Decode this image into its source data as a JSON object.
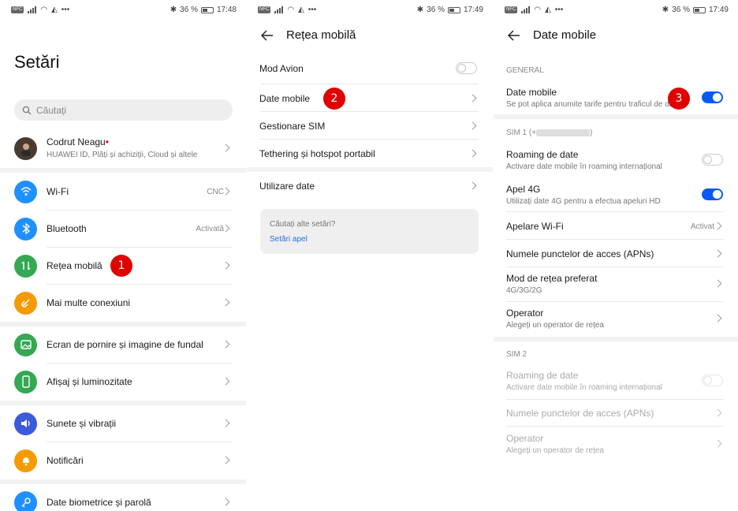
{
  "status": {
    "battery": "36 %",
    "time": "17:48",
    "time2": "17:49"
  },
  "colors": {
    "accent": "#0a59f7",
    "badge": "#e00000",
    "wifi": "#1e90ff",
    "bluetooth": "#1e90ff",
    "mobile": "#34a853",
    "more": "#f59b00",
    "home": "#34a853",
    "display": "#34a853",
    "sound": "#3b5bdb",
    "notif": "#f59b00",
    "bio": "#1e90ff"
  },
  "p1": {
    "title": "Setări",
    "search_placeholder": "Căutați",
    "account": {
      "name": "Codrut Neagu",
      "sub": "HUAWEI ID, Plăți și achiziții, Cloud și altele"
    },
    "items": [
      {
        "label": "Wi-Fi",
        "value": "CNC",
        "icon": "wifi-icon"
      },
      {
        "label": "Bluetooth",
        "value": "Activată",
        "icon": "bluetooth-icon"
      },
      {
        "label": "Rețea mobilă",
        "value": "",
        "icon": "mobile-network-icon"
      },
      {
        "label": "Mai multe conexiuni",
        "value": "",
        "icon": "link-icon"
      },
      {
        "label": "Ecran de pornire și imagine de fundal",
        "value": "",
        "icon": "image-icon"
      },
      {
        "label": "Afișaj și luminozitate",
        "value": "",
        "icon": "phone-icon"
      },
      {
        "label": "Sunete și vibrații",
        "value": "",
        "icon": "speaker-icon"
      },
      {
        "label": "Notificări",
        "value": "",
        "icon": "bell-icon"
      },
      {
        "label": "Date biometrice și parolă",
        "value": "",
        "icon": "key-icon"
      }
    ],
    "badge": "1"
  },
  "p2": {
    "title": "Rețea mobilă",
    "items": [
      "Mod Avion",
      "Date mobile",
      "Gestionare SIM",
      "Tethering și hotspot portabil",
      "Utilizare date"
    ],
    "help_question": "Căutați alte setări?",
    "help_link": "Setări apel",
    "badge": "2",
    "airplane_on": false
  },
  "p3": {
    "title": "Date mobile",
    "general": "GENERAL",
    "data_label": "Date mobile",
    "data_sub": "Se pot aplica anumite tarife pentru traficul de date",
    "sim1": "SIM 1 (+",
    "sim1_close": ")",
    "roaming_label": "Roaming de date",
    "roaming_sub": "Activare date mobile în roaming internațional",
    "apel4g_label": "Apel 4G",
    "apel4g_sub": "Utilizați date 4G pentru a efectua apeluri HD",
    "wifi_call_label": "Apelare Wi-Fi",
    "wifi_call_value": "Activat",
    "apn_label": "Numele punctelor de acces (APNs)",
    "mode_label": "Mod de rețea preferat",
    "mode_value": "4G/3G/2G",
    "operator_label": "Operator",
    "operator_sub": "Alegeți un operator de rețea",
    "sim2": "SIM 2",
    "badge": "3",
    "toggles": {
      "data": true,
      "roaming": false,
      "apel4g": true,
      "roaming2": false
    }
  }
}
